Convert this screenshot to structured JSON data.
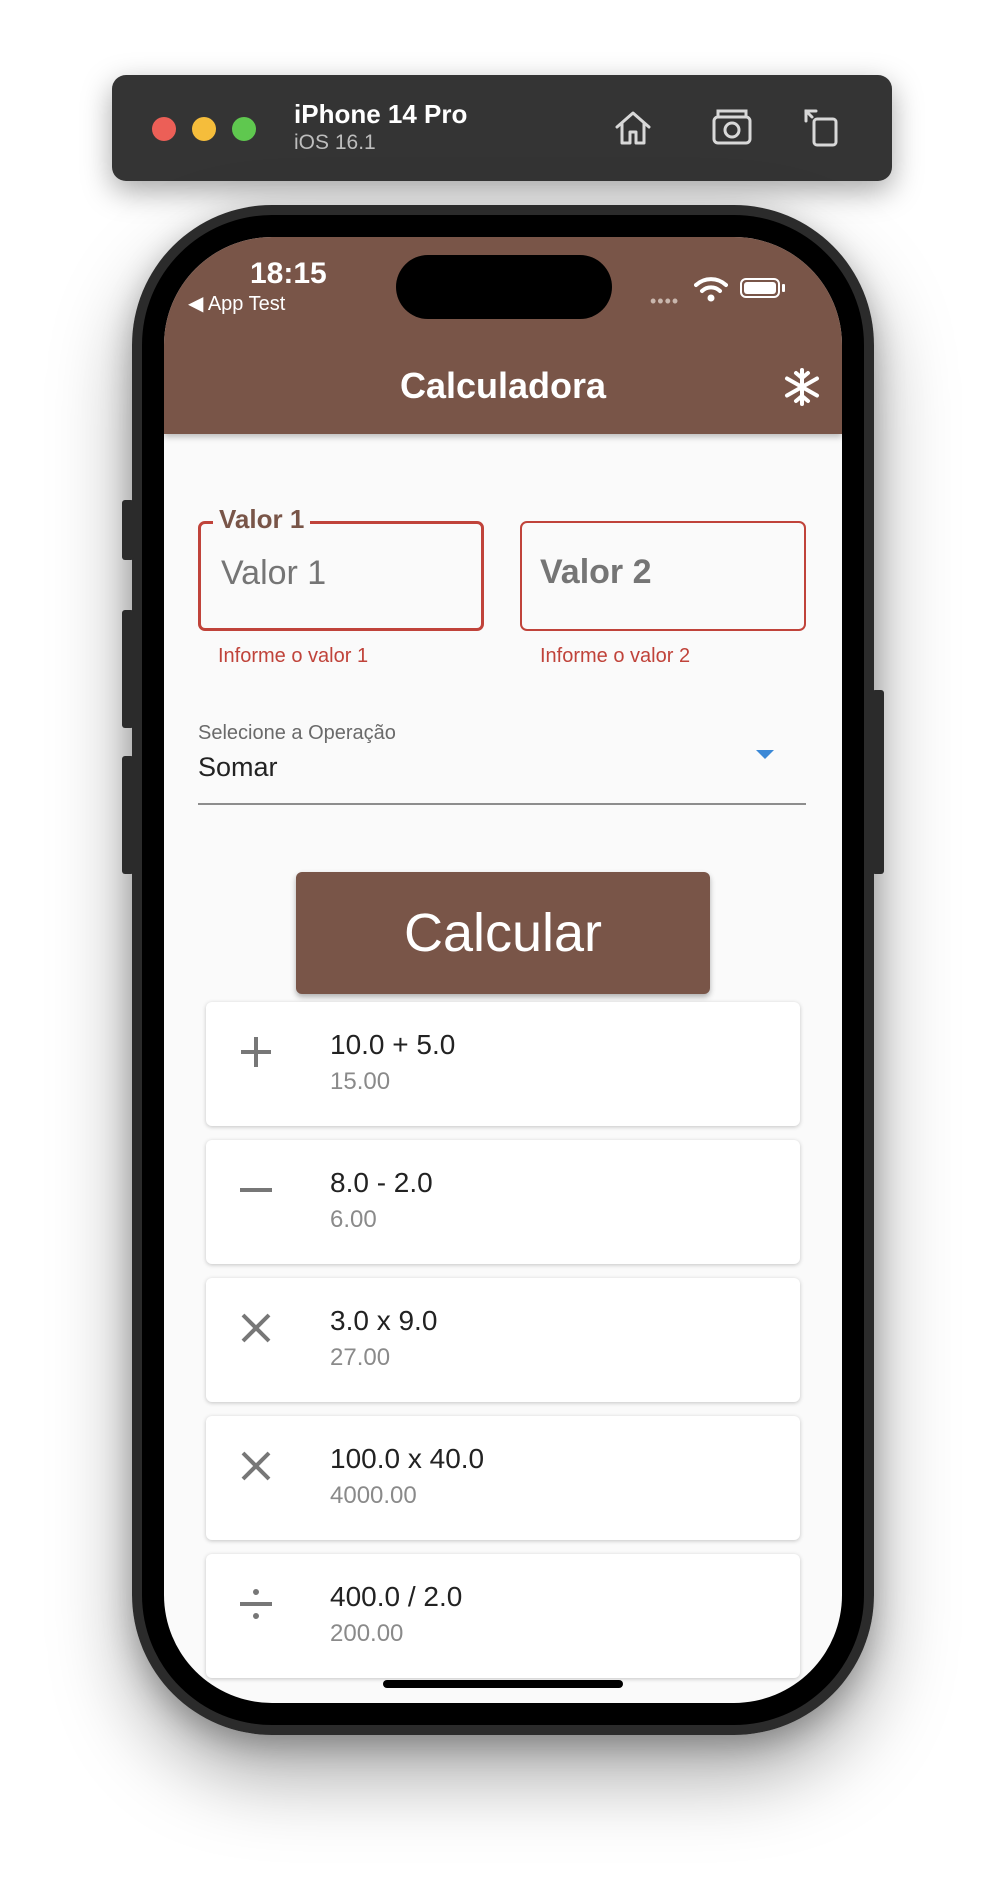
{
  "simulator": {
    "device": "iPhone 14 Pro",
    "os": "iOS 16.1",
    "icons": [
      "home-icon",
      "screenshot-icon",
      "rotate-icon"
    ]
  },
  "status_bar": {
    "time": "18:15",
    "back_app": "◀ App Test",
    "signal": "••••"
  },
  "appbar": {
    "title": "Calculadora",
    "action_icon": "snowflake-icon"
  },
  "form": {
    "valor1": {
      "label": "Valor 1",
      "placeholder": "Valor 1",
      "value": "",
      "error": "Informe o valor 1"
    },
    "valor2": {
      "placeholder": "Valor 2",
      "value": "",
      "error": "Informe o valor 2"
    },
    "operation": {
      "label": "Selecione a Operação",
      "value": "Somar"
    },
    "calculate_label": "Calcular"
  },
  "history": [
    {
      "icon": "plus-icon",
      "expression": "10.0 + 5.0",
      "result": "15.00"
    },
    {
      "icon": "minus-icon",
      "expression": "8.0 - 2.0",
      "result": "6.00"
    },
    {
      "icon": "multiply-icon",
      "expression": "3.0 x 9.0",
      "result": "27.00"
    },
    {
      "icon": "multiply-icon",
      "expression": "100.0 x 40.0",
      "result": "4000.00"
    },
    {
      "icon": "divide-icon",
      "expression": "400.0 / 2.0",
      "result": "200.00"
    }
  ],
  "colors": {
    "primary": "#795548",
    "error": "#c0433a",
    "dropdown_accent": "#3b88d6",
    "background": "#fafafa"
  }
}
